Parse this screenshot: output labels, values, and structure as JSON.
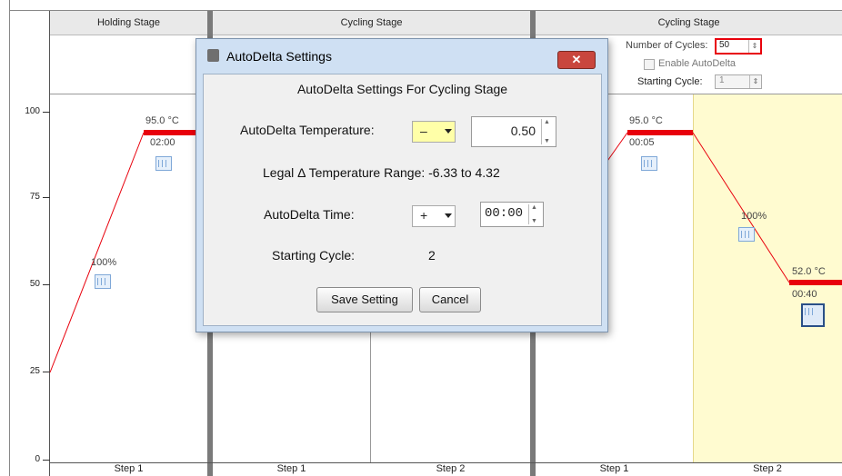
{
  "axis": {
    "y_ticks": [
      "100",
      "75",
      "50",
      "25",
      "0"
    ]
  },
  "stages": [
    {
      "title": "Holding Stage"
    },
    {
      "title": "Cycling Stage"
    },
    {
      "title": "Cycling Stage"
    }
  ],
  "cycling_controls": {
    "cycles_label": "Number of Cycles:",
    "cycles_value": "50",
    "enable_autodelta_label": "Enable AutoDelta",
    "starting_cycle_label": "Starting Cycle:",
    "starting_cycle_value": "1"
  },
  "steps": {
    "holding_step1": {
      "temp": "95.0 °C",
      "time": "02:00",
      "ramp": "100%",
      "label": "Step 1"
    },
    "cycling1_step1": {
      "label": "Step 1"
    },
    "cycling1_step2": {
      "label": "Step 2"
    },
    "cycling2_step1": {
      "temp": "95.0 °C",
      "time": "00:05",
      "label": "Step 1"
    },
    "cycling2_step2": {
      "temp": "52.0 °C",
      "time": "00:40",
      "ramp": "100%",
      "label": "Step 2"
    }
  },
  "dialog": {
    "title": "AutoDelta Settings",
    "close_label": "✕",
    "heading": "AutoDelta Settings For Cycling Stage",
    "temperature_label": "AutoDelta Temperature:",
    "temperature_sign": "–",
    "temperature_value": "0.50",
    "legal_range": "Legal Δ Temperature Range: -6.33 to 4.32",
    "time_label": "AutoDelta Time:",
    "time_sign": "+",
    "time_value": "00:00",
    "starting_cycle_label": "Starting Cycle:",
    "starting_cycle_value": "2",
    "save_label": "Save Setting",
    "cancel_label": "Cancel"
  },
  "colors": {
    "temp_bar": "#e8000c",
    "highlight_step": "#fffbd0",
    "cycles_highlight": "#e8000c"
  }
}
